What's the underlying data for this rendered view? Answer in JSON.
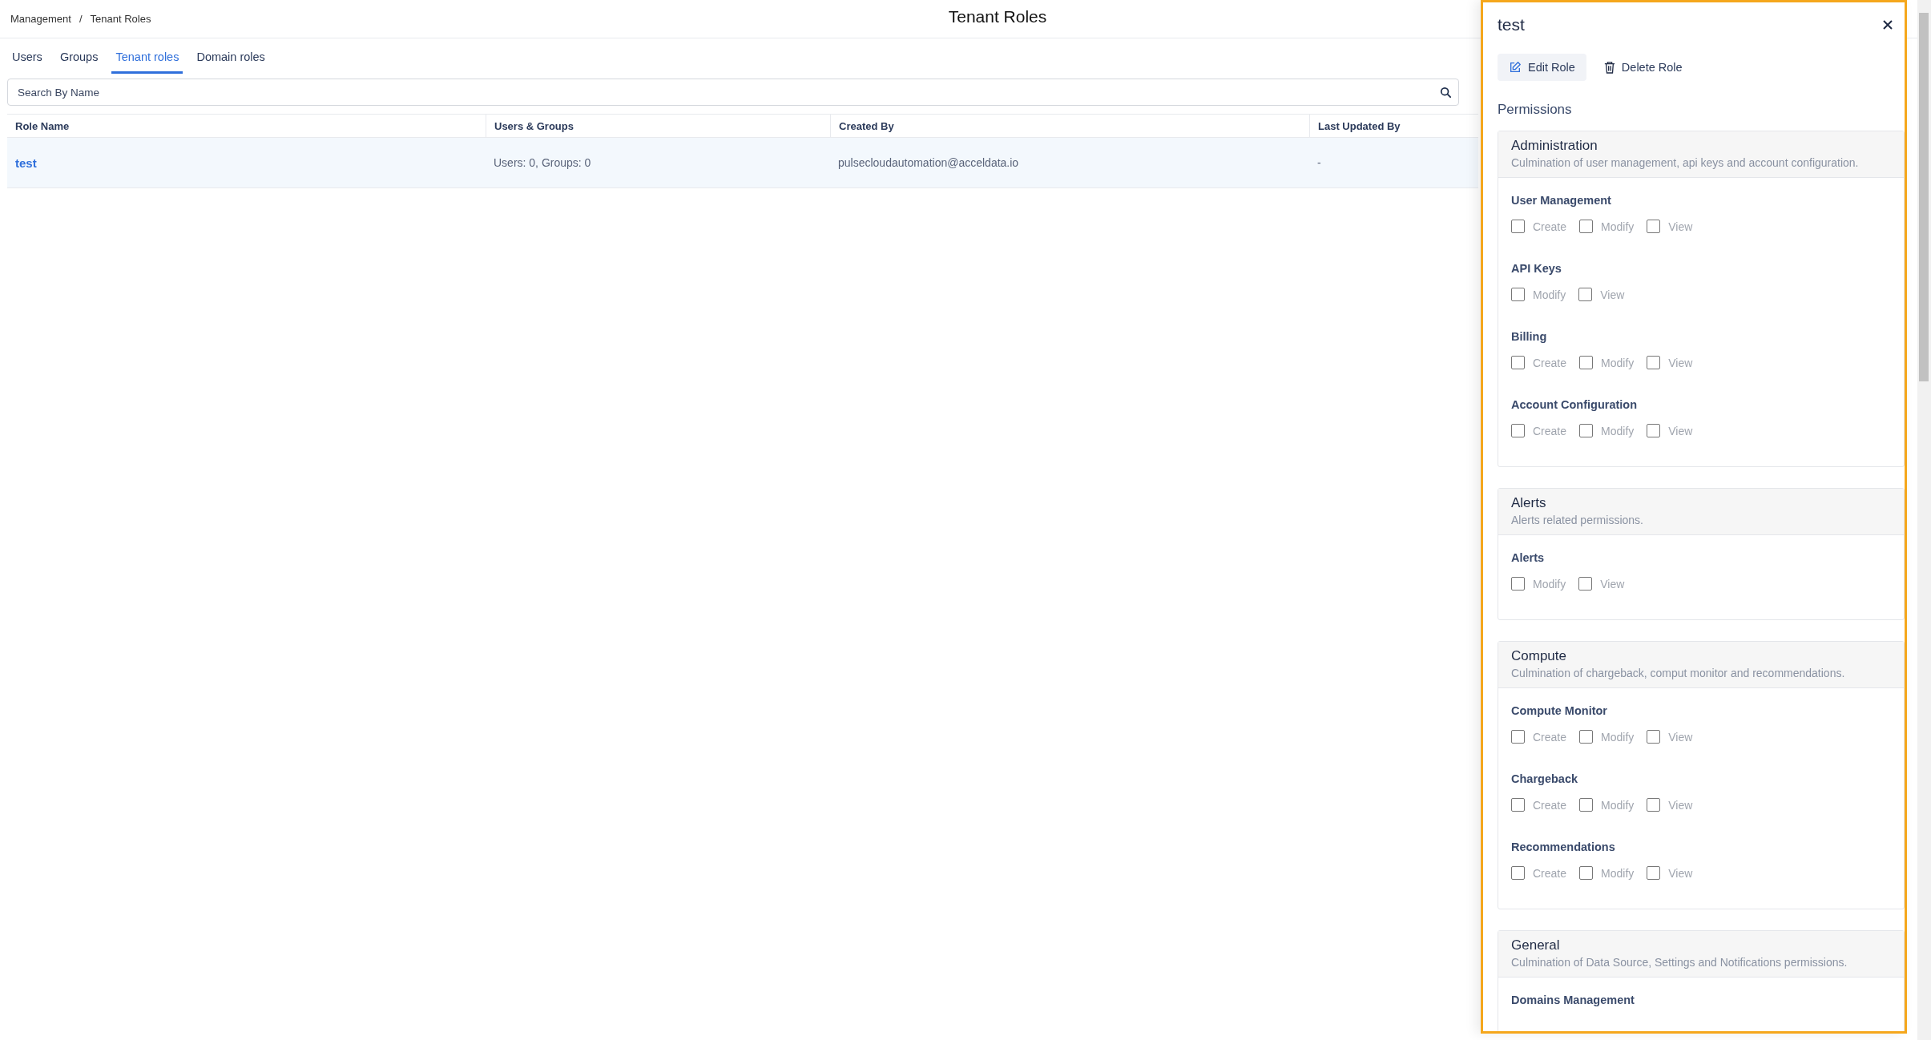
{
  "breadcrumb": {
    "items": [
      "Management",
      "Tenant Roles"
    ],
    "separator": "/"
  },
  "page_title": "Tenant Roles",
  "tabs": [
    {
      "label": "Users",
      "selected": false
    },
    {
      "label": "Groups",
      "selected": false
    },
    {
      "label": "Tenant roles",
      "selected": true
    },
    {
      "label": "Domain roles",
      "selected": false
    }
  ],
  "search": {
    "placeholder": "Search By Name"
  },
  "table": {
    "columns": [
      "Role Name",
      "Users & Groups",
      "Created By",
      "Last Updated By"
    ],
    "rows": [
      {
        "selected": true,
        "cells": [
          "test",
          "Users: 0, Groups: 0",
          "pulsecloudautomation@acceldata.io",
          "-"
        ]
      }
    ]
  },
  "panel": {
    "title": "test",
    "actions": [
      {
        "kind": "edit",
        "label": "Edit Role"
      },
      {
        "kind": "delete",
        "label": "Delete Role"
      }
    ],
    "heading": "Permissions",
    "sections": [
      {
        "title": "Administration",
        "description": "Culmination of user management, api keys and account configuration.",
        "groups": [
          {
            "name": "User Management",
            "options": [
              {
                "label": "Create",
                "checked": false
              },
              {
                "label": "Modify",
                "checked": false
              },
              {
                "label": "View",
                "checked": false
              }
            ]
          },
          {
            "name": "API Keys",
            "options": [
              {
                "label": "Modify",
                "checked": false
              },
              {
                "label": "View",
                "checked": false
              }
            ]
          },
          {
            "name": "Billing",
            "options": [
              {
                "label": "Create",
                "checked": false
              },
              {
                "label": "Modify",
                "checked": false
              },
              {
                "label": "View",
                "checked": false
              }
            ]
          },
          {
            "name": "Account Configuration",
            "options": [
              {
                "label": "Create",
                "checked": false
              },
              {
                "label": "Modify",
                "checked": false
              },
              {
                "label": "View",
                "checked": false
              }
            ]
          }
        ]
      },
      {
        "title": "Alerts",
        "description": "Alerts related permissions.",
        "groups": [
          {
            "name": "Alerts",
            "options": [
              {
                "label": "Modify",
                "checked": false
              },
              {
                "label": "View",
                "checked": false
              }
            ]
          }
        ]
      },
      {
        "title": "Compute",
        "description": "Culmination of chargeback, comput monitor and recommendations.",
        "groups": [
          {
            "name": "Compute Monitor",
            "options": [
              {
                "label": "Create",
                "checked": false
              },
              {
                "label": "Modify",
                "checked": false
              },
              {
                "label": "View",
                "checked": false
              }
            ]
          },
          {
            "name": "Chargeback",
            "options": [
              {
                "label": "Create",
                "checked": false
              },
              {
                "label": "Modify",
                "checked": false
              },
              {
                "label": "View",
                "checked": false
              }
            ]
          },
          {
            "name": "Recommendations",
            "options": [
              {
                "label": "Create",
                "checked": false
              },
              {
                "label": "Modify",
                "checked": false
              },
              {
                "label": "View",
                "checked": false
              }
            ]
          }
        ]
      },
      {
        "title": "General",
        "description": "Culmination of Data Source, Settings and Notifications permissions.",
        "groups": [
          {
            "name": "Domains Management"
          }
        ]
      }
    ]
  }
}
